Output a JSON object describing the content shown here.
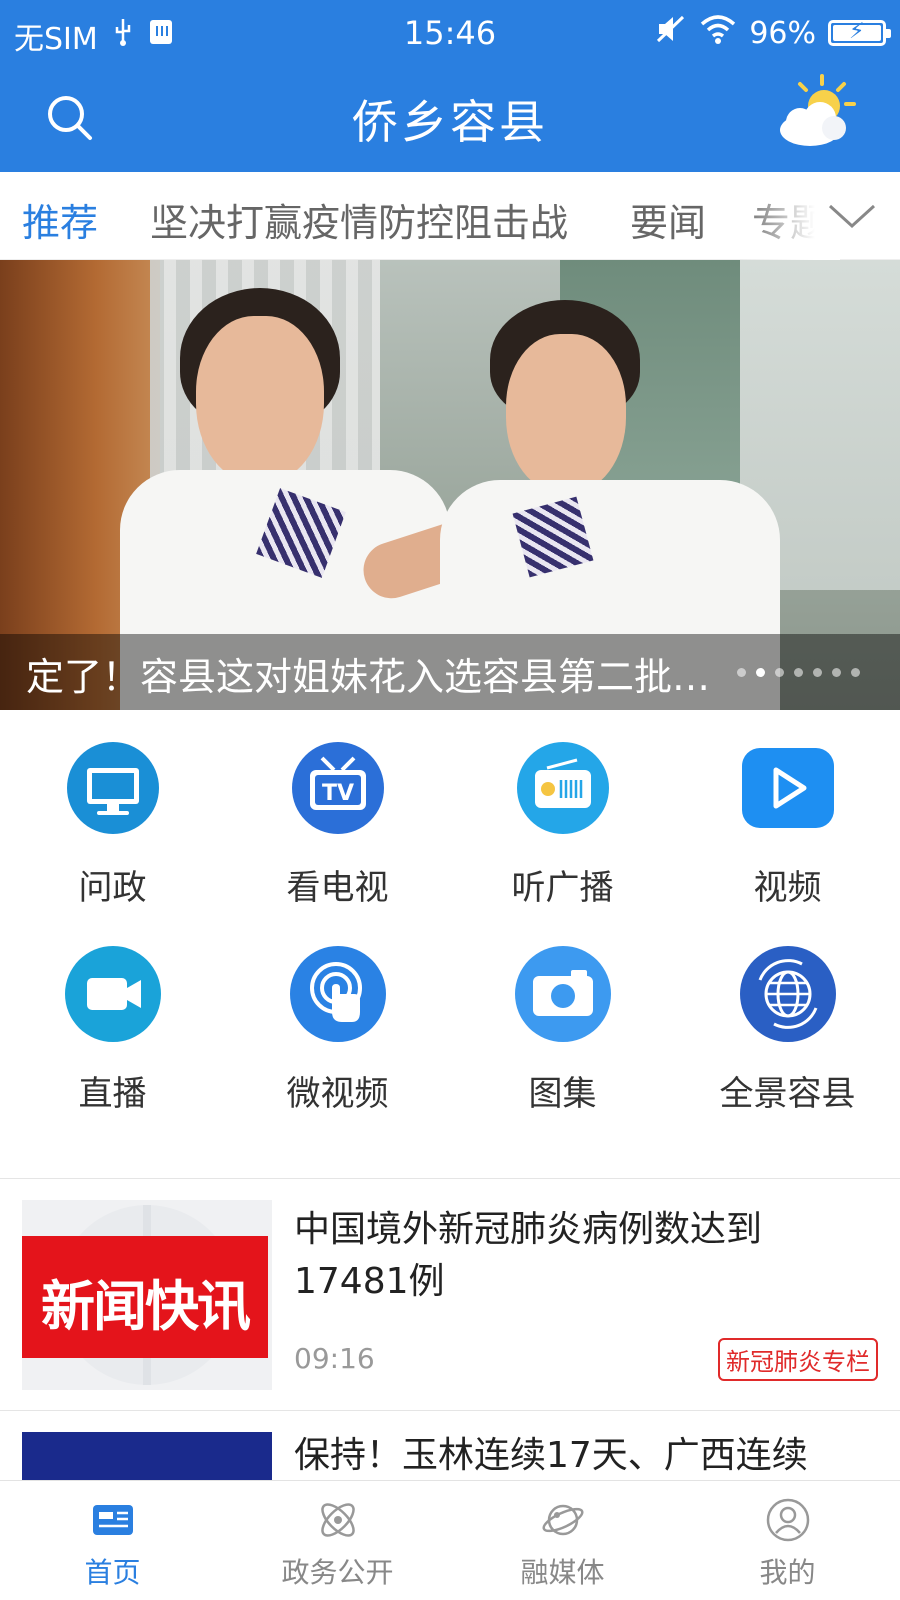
{
  "status_bar": {
    "carrier": "无SIM",
    "time": "15:46",
    "battery": "96%"
  },
  "header": {
    "title": "侨乡容县",
    "search_icon": "search-icon",
    "weather_icon": "weather-partly-sunny-icon"
  },
  "tabs": [
    {
      "label": "推荐",
      "active": true
    },
    {
      "label": "坚决打赢疫情防控阻击战",
      "active": false
    },
    {
      "label": "要闻",
      "active": false
    },
    {
      "label": "专题",
      "active": false
    }
  ],
  "banner": {
    "caption": "定了！容县这对姐妹花入选容县第二批道德模范",
    "slide_count": 7,
    "active_slide": 2
  },
  "shortcuts": [
    {
      "label": "问政",
      "icon": "monitor-icon",
      "color": "#1a8fd6"
    },
    {
      "label": "看电视",
      "icon": "tv-icon",
      "color": "#2b6fd8"
    },
    {
      "label": "听广播",
      "icon": "radio-icon",
      "color": "#24a6e8"
    },
    {
      "label": "视频",
      "icon": "play-icon",
      "color": "#1e8ff2"
    },
    {
      "label": "直播",
      "icon": "camera-icon",
      "color": "#1aa3d9"
    },
    {
      "label": "微视频",
      "icon": "touch-icon",
      "color": "#2a82e4"
    },
    {
      "label": "图集",
      "icon": "photo-icon",
      "color": "#3d9af0"
    },
    {
      "label": "全景容县",
      "icon": "globe-icon",
      "color": "#2a5fc4"
    }
  ],
  "news": [
    {
      "title": "中国境外新冠肺炎病例数达到17481例",
      "time": "09:16",
      "tag": "新冠肺炎专栏",
      "thumb_text": "新闻快讯"
    },
    {
      "title": "保持！玉林连续17天、广西连续"
    }
  ],
  "bottom_nav": [
    {
      "label": "首页",
      "icon": "home-news-icon",
      "active": true
    },
    {
      "label": "政务公开",
      "icon": "atom-icon",
      "active": false
    },
    {
      "label": "融媒体",
      "icon": "planet-icon",
      "active": false
    },
    {
      "label": "我的",
      "icon": "user-icon",
      "active": false
    }
  ],
  "colors": {
    "brand": "#2a7fe0",
    "tag_red": "#e02a2a"
  }
}
